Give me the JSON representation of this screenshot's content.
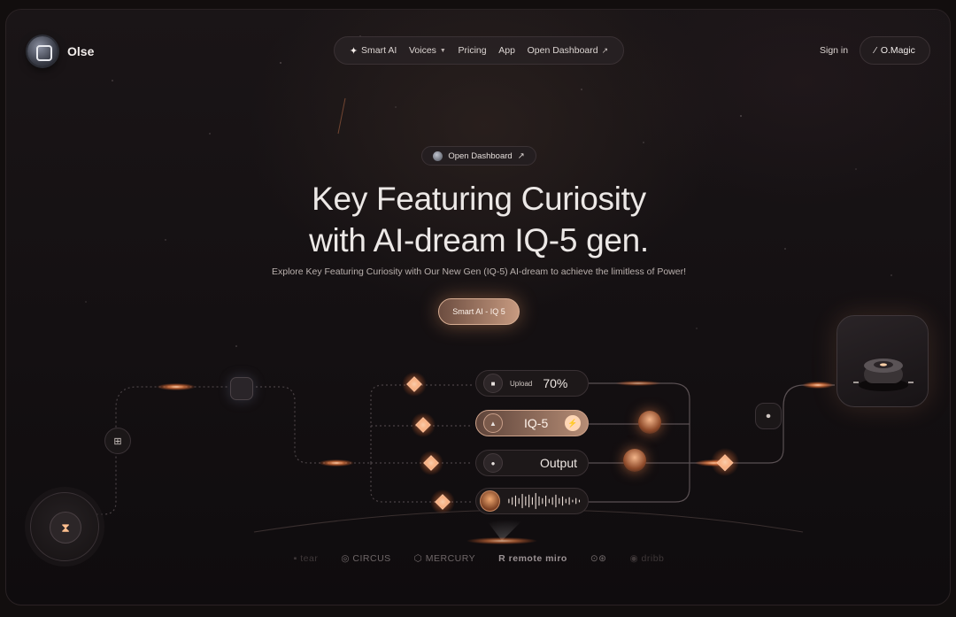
{
  "app": {
    "brand": "Olse"
  },
  "nav": {
    "items": [
      {
        "label": "Smart AI",
        "icon": "sparkle-icon"
      },
      {
        "label": "Voices",
        "icon": "chevron-down-icon"
      },
      {
        "label": "Pricing"
      },
      {
        "label": "App"
      },
      {
        "label": "Open Dashboard",
        "icon": "arrow-up-right-icon"
      }
    ],
    "sign_in": "Sign in",
    "magic_button": "O.Magic"
  },
  "hero": {
    "pill": "Open Dashboard",
    "title_line1": "Key Featuring Curiosity",
    "title_line2": "with AI-dream IQ-5 gen.",
    "subtitle": "Explore Key Featuring Curiosity with Our New Gen (IQ-5) AI-dream to achieve the limitless of Power!",
    "cta": "Smart AI - IQ 5"
  },
  "diagram": {
    "upload": {
      "label": "Upload",
      "value": "70%"
    },
    "iq": {
      "label": "IQ-5"
    },
    "output": {
      "label": "Output"
    }
  },
  "logos": [
    "▪ tear",
    "◎ CIRCUS",
    "⬡ MERCURY",
    "R remote miro",
    "⊙⊛",
    "◉ dribb"
  ],
  "colors": {
    "accent": "#e8a27a",
    "background": "#141012",
    "glow": "#ff8a4a"
  }
}
